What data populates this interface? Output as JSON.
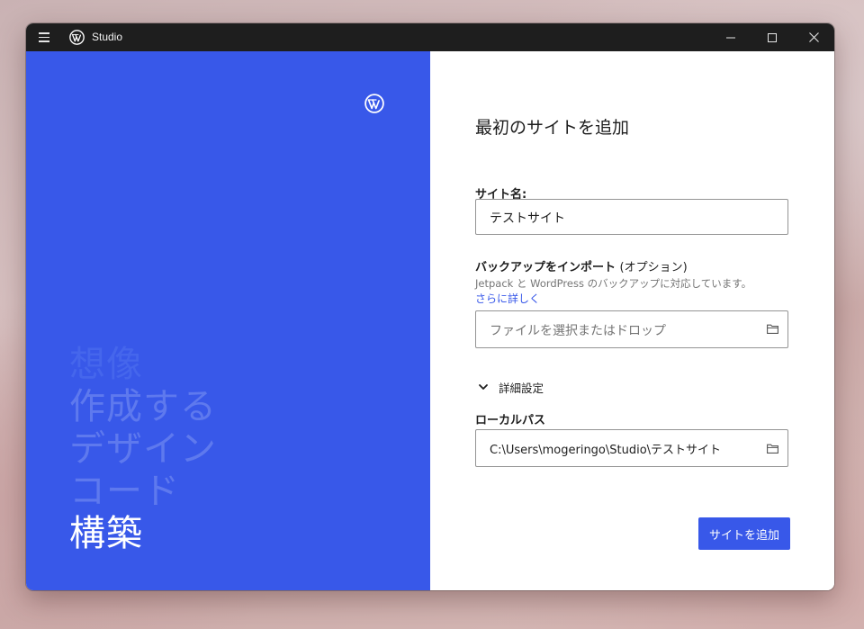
{
  "window": {
    "title": "Studio"
  },
  "onboarding": {
    "words": [
      "想像",
      "作成する",
      "デザイン",
      "コード",
      "構築"
    ]
  },
  "form": {
    "heading": "最初のサイトを追加",
    "site_name_label": "サイト名:",
    "site_name_value": "テストサイト",
    "import_label": "バックアップをインポート",
    "import_optional": "(オプション)",
    "import_help": "Jetpack と WordPress のバックアップに対応しています。",
    "learn_more": "さらに詳しく",
    "file_placeholder": "ファイルを選択またはドロップ",
    "advanced_label": "詳細設定",
    "local_path_label": "ローカルパス",
    "local_path_value": "C:\\Users\\mogeringo\\Studio\\テストサイト",
    "submit_label": "サイトを追加"
  },
  "colors": {
    "accent": "#3858e9",
    "titlebar": "#1e1e1e"
  },
  "icons": {
    "menu": "hamburger-icon",
    "logo": "wordpress-logo-icon",
    "minimize": "minimize-icon",
    "maximize": "maximize-icon",
    "close": "close-icon",
    "folder": "folder-icon",
    "chevron": "chevron-down-icon"
  }
}
